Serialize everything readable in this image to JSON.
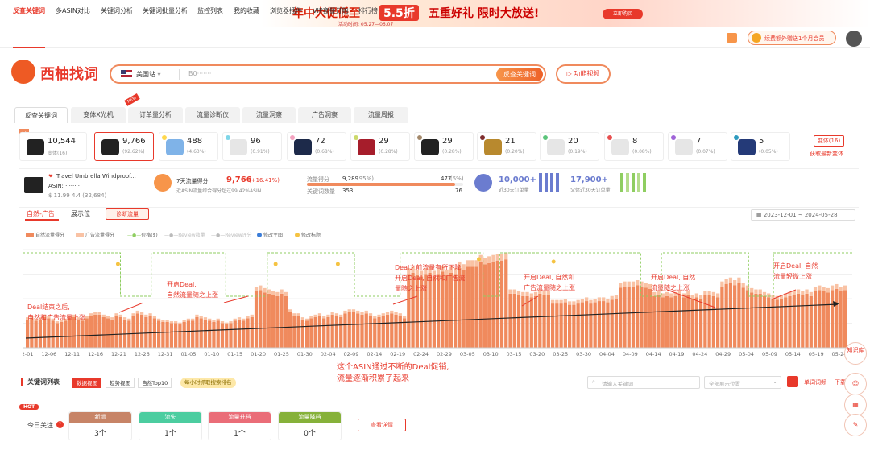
{
  "banner": {
    "headline": "年中大促低至",
    "discount": "5.5折",
    "promo": "五重好礼 限时大放送!",
    "period": "活动时间: 05.27—06.07",
    "cta": "立即购买"
  },
  "nav": {
    "items": [
      "反查关键词",
      "多ASIN对比",
      "关键词分析",
      "关键词批量分析",
      "监控列表",
      "我的收藏",
      "浏览器插件",
      "VIP套餐订购",
      "排行榜"
    ],
    "promo": "续费额外赠送1个月会员"
  },
  "logo": {
    "text": "西柚找词"
  },
  "search": {
    "site": "美国站",
    "value": "B0·······",
    "button": "反查关键词",
    "video": "功能视频"
  },
  "tabs": {
    "items": [
      "反查关键词",
      "变体X光机",
      "订单量分析",
      "流量诊断仪",
      "流量洞察",
      "广告洞察",
      "流量周报"
    ],
    "new_badge": "NEW"
  },
  "variants": {
    "cards": [
      {
        "value": "10,544",
        "sub": "变体(16)",
        "dot": "",
        "img": "#222"
      },
      {
        "value": "9,766",
        "sub": "(92.62%)",
        "dot": "",
        "img": "#222"
      },
      {
        "value": "488",
        "sub": "(4.63%)",
        "dot": "#ffd84d",
        "img": "#7fb3e8"
      },
      {
        "value": "96",
        "sub": "(0.91%)",
        "dot": "#7fd6e8",
        "img": "#e6e6e6"
      },
      {
        "value": "72",
        "sub": "(0.68%)",
        "dot": "#f4a3c0",
        "img": "#1d2a4a"
      },
      {
        "value": "29",
        "sub": "(0.28%)",
        "dot": "#ccd96b",
        "img": "#a61d2b"
      },
      {
        "value": "29",
        "sub": "(0.28%)",
        "dot": "#a4896b",
        "img": "#222"
      },
      {
        "value": "21",
        "sub": "(0.20%)",
        "dot": "#7f2e2e",
        "img": "#b8892e"
      },
      {
        "value": "20",
        "sub": "(0.19%)",
        "dot": "#5bc47a",
        "img": "#e6e6e6"
      },
      {
        "value": "8",
        "sub": "(0.08%)",
        "dot": "#e84f4f",
        "img": "#e6e6e6"
      },
      {
        "value": "7",
        "sub": "(0.07%)",
        "dot": "#a064d8",
        "img": "#e6e6e6"
      },
      {
        "value": "5",
        "sub": "(0.05%)",
        "dot": "#2e9bbf",
        "img": "#243a78"
      }
    ],
    "more_btn": "变体(16)",
    "refresh": "获取最新变体"
  },
  "product": {
    "title": "Travel Umbrella Windproof...",
    "asin": "ASIN: ········",
    "meta": "$ 11.99  4.4 (32,684)",
    "score_label": "7天流量得分",
    "score": "9,766",
    "score_change": "(+16.41%)",
    "score_note": "近ASIN流量综合得分超过99.42%ASIN",
    "flow_label": "流量得分",
    "flow_value": "9,289",
    "flow_pct": "(95%)",
    "flow_right": "477",
    "flow_right_pct": "(5%)",
    "kw_label": "关键词数量",
    "kw_value": "353",
    "kw_right": "76",
    "orders_value": "10,000+",
    "orders_label": "近30天订单量",
    "variant_orders_value": "17,900+",
    "variant_orders_label": "父体近30天订单量"
  },
  "chart_panel": {
    "tabs": [
      "自然-广告",
      "展示位"
    ],
    "diagnose": "诊断流量",
    "date_range": "2023-12-01  ~  2024-05-28",
    "legend": [
      "自然流量得分",
      "广告流量得分",
      "价格($)",
      "Review数量",
      "Review评分",
      "修改主图",
      "修改标题"
    ],
    "legend_colors": {
      "organic": "#f08a5d",
      "ads": "#f9c2a4",
      "price": "#8fce61",
      "review": "#cccccc",
      "main_img": "#3b7dd8",
      "title_chg": "#f5c342"
    }
  },
  "annotations": {
    "a1": "Deal结束之后,\n自然和广告流量上涨",
    "a2": "开启Deal,\n自然流量随之上涨",
    "a3": "Deal之前流量有所下降,\n开启Deal, 自然和广告流\n量随之上涨",
    "a4": "开启Deal, 自然和\n广告流量随之上涨",
    "a5": "开启Deal, 自然\n流量随之上涨",
    "a6": "开启Deal, 自然\n流量轻微上涨",
    "summary": "这个ASIN通过不断的Deal促销,\n流量逐渐积累了起来"
  },
  "chart_data": {
    "type": "bar",
    "x_ticks": [
      "12-01",
      "12-06",
      "12-11",
      "12-16",
      "12-21",
      "12-26",
      "12-31",
      "01-05",
      "01-10",
      "01-15",
      "01-20",
      "01-25",
      "01-30",
      "02-04",
      "02-09",
      "02-14",
      "02-19",
      "02-24",
      "02-29",
      "03-05",
      "03-10",
      "03-15",
      "03-20",
      "03-25",
      "03-30",
      "04-04",
      "04-09",
      "04-14",
      "04-19",
      "04-24",
      "04-29",
      "05-04",
      "05-09",
      "05-14",
      "05-19",
      "05-24"
    ],
    "organic_relative": [
      0.23,
      0.24,
      0.22,
      0.23,
      0.25,
      0.24,
      0.22,
      0.2,
      0.21,
      0.22,
      0.24,
      0.25,
      0.23,
      0.22,
      0.24,
      0.26,
      0.27,
      0.27,
      0.25,
      0.24,
      0.23,
      0.26,
      0.25,
      0.23,
      0.22,
      0.26,
      0.28,
      0.27,
      0.25,
      0.26,
      0.24,
      0.22,
      0.21,
      0.21,
      0.2,
      0.2,
      0.19,
      0.21,
      0.22,
      0.22,
      0.25,
      0.24,
      0.23,
      0.22,
      0.21,
      0.22,
      0.2,
      0.19,
      0.2,
      0.22,
      0.23,
      0.22,
      0.24,
      0.25,
      0.46,
      0.47,
      0.45,
      0.44,
      0.43,
      0.42,
      0.44,
      0.42,
      0.29,
      0.26,
      0.26,
      0.23,
      0.22,
      0.24,
      0.25,
      0.26,
      0.24,
      0.25,
      0.27,
      0.26,
      0.25,
      0.28,
      0.29,
      0.29,
      0.28,
      0.27,
      0.28,
      0.26,
      0.24,
      0.25,
      0.26,
      0.27,
      0.28,
      0.27,
      0.26,
      0.24,
      0.6,
      0.61,
      0.59,
      0.58,
      0.6,
      0.61,
      0.58,
      0.6,
      0.62,
      0.59,
      0.61,
      0.6,
      0.65,
      0.63,
      0.66,
      0.66,
      0.66,
      0.7,
      0.68,
      0.69,
      0.7,
      0.71,
      0.71,
      0.72,
      0.44,
      0.44,
      0.43,
      0.42,
      0.42,
      0.41,
      0.42,
      0.44,
      0.43,
      0.43,
      0.36,
      0.36,
      0.36,
      0.37,
      0.35,
      0.35,
      0.36,
      0.37,
      0.38,
      0.36,
      0.37,
      0.38,
      0.38,
      0.37,
      0.39,
      0.4,
      0.49,
      0.5,
      0.5,
      0.5,
      0.51,
      0.5,
      0.49,
      0.48,
      0.42,
      0.43,
      0.41,
      0.42,
      0.41,
      0.42,
      0.43,
      0.41,
      0.43,
      0.4,
      0.41,
      0.4,
      0.43,
      0.43,
      0.42,
      0.41,
      0.5,
      0.52,
      0.53,
      0.51,
      0.53,
      0.49,
      0.47,
      0.45,
      0.44,
      0.44,
      0.42,
      0.41,
      0.4,
      0.39,
      0.4,
      0.41,
      0.42,
      0.43,
      0.44,
      0.43,
      0.44,
      0.42,
      0.46,
      0.47,
      0.46,
      0.45,
      0.47,
      0.48,
      0.46,
      0.47
    ],
    "price_line": "elevated during Deal windows: 12-21~12-31, 01-15~01-30, 02-14~02-22, 03-10~03-15, 04-09~04-14, 05-09~05-14",
    "trend": "upward"
  },
  "keywords": {
    "title": "关键词列表",
    "view_tabs": [
      "数据视图",
      "趋势视图",
      "自然Top10"
    ],
    "hourly": "每小时抓取搜索排名",
    "search_placeholder": "请输入关键词",
    "position_placeholder": "全部展示位置",
    "single_rank": "单词词频",
    "download": "下载",
    "hot": "HOT",
    "today": "今日关注",
    "stats": [
      {
        "label": "新增",
        "value": "3个",
        "color": "#c78467"
      },
      {
        "label": "流失",
        "value": "1个",
        "color": "#4ccda0"
      },
      {
        "label": "流量升档",
        "value": "1个",
        "color": "#ea6d78"
      },
      {
        "label": "流量降档",
        "value": "0个",
        "color": "#86b13a"
      }
    ],
    "detail_btn": "查看详情"
  },
  "side": {
    "kb": "知识库"
  }
}
